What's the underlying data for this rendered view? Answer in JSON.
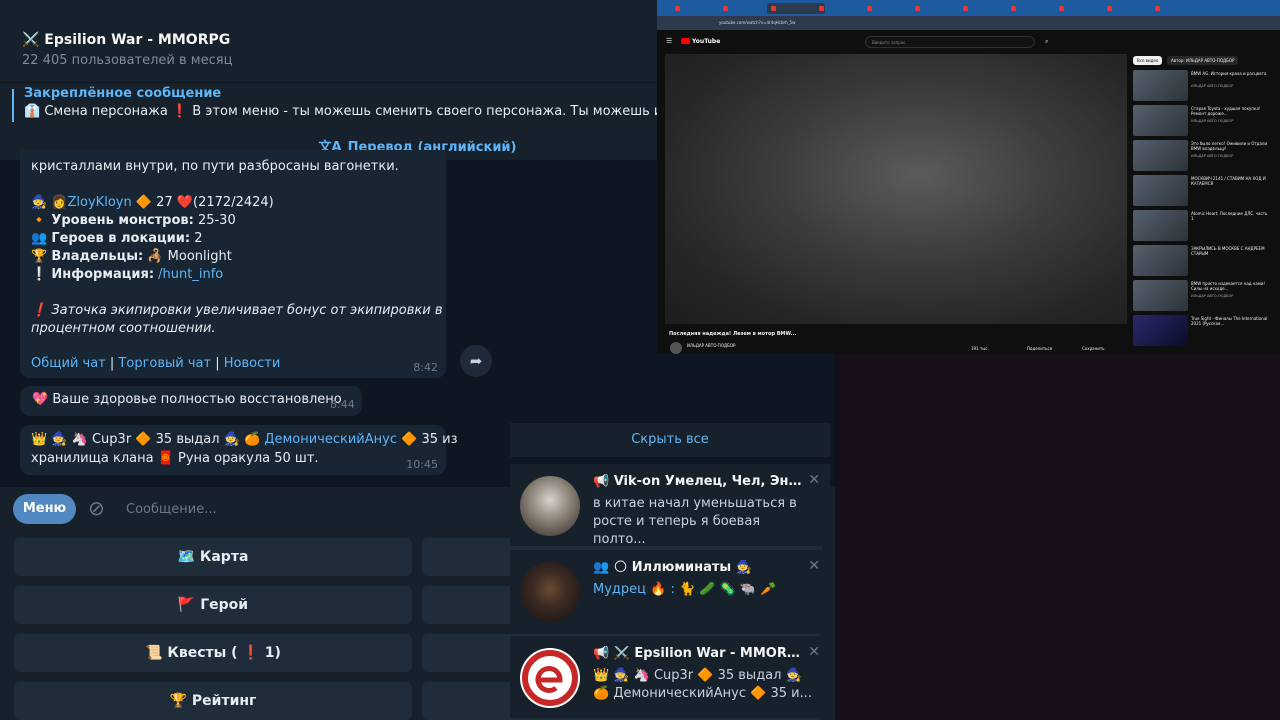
{
  "telegram": {
    "header": {
      "title": "⚔️ Epsilion War - MMORPG",
      "subtitle": "22 405 пользователей в месяц"
    },
    "pinned": {
      "label": "Закреплённое сообщение",
      "text": "👔 Смена персонажа ❗ В этом меню - ты можешь сменить своего персонажа. Ты можешь иметь д"
    },
    "translate_label": "Перевод (английский)",
    "message1": {
      "lines": [
        "кристаллами внутри, по пути разбросаны вагонетки.",
        "🧙 👩 ZloyKloyn 🔶 27 ❤️ (2172/2424)",
        "🔸 Уровень монстров: 25-30",
        "👥 Героев в локации: 2",
        "🏆 Владельцы: 🦂 Moonlight",
        "❕ Информация: /hunt_info",
        "❗ Заточка экипировки увеличивает бонус от экипировки в",
        "процентном соотношении."
      ],
      "player_name": "ZloyKloyn",
      "level": "27",
      "hp": "(2172/2424)",
      "monster_level_label": "Уровень монстров:",
      "monster_level": "25-30",
      "heroes_label": "Героев в локации:",
      "heroes": "2",
      "owners_label": "Владельцы:",
      "owners": "Moonlight",
      "info_label": "Информация:",
      "info_link": "/hunt_info",
      "tip_1": "Заточка экипировки увеличивает бонус от экипировки в",
      "tip_2": "процентном соотношении.",
      "links": [
        "Общий чат",
        "Торговый чат",
        "Новости"
      ],
      "time": "8:42"
    },
    "message2": {
      "text": "💖 Ваше здоровье полностью восстановлено",
      "time": "8:44"
    },
    "message3": {
      "line1_player": "Cup3r",
      "line1_level": "35 выдал",
      "line1_target": "ДемоническийАнус",
      "line1_tail": "35 из",
      "line2": "хранилища клана 🧧 Руна оракула 50 шт.",
      "time": "10:45"
    },
    "input": {
      "menu_label": "Меню",
      "placeholder": "Сообщение..."
    },
    "keyboard": [
      {
        "label": "🗺️ Карта"
      },
      {
        "label": "🚩 Герой"
      },
      {
        "label": "📜 Квесты ( ❗ 1)"
      },
      {
        "label": "🏆 Рейтинг"
      }
    ]
  },
  "notifications": {
    "hide_all": "Скрыть все",
    "items": [
      {
        "title": "📢 Vik-on Умелец, Чел, Энтузи...",
        "text": "в китае начал уменьшаться в росте и теперь я боевая полто..."
      },
      {
        "title": "👥 🌕 Иллюминаты 🧙",
        "text": "Мудрец 🔥 : 🐈 🥒 🦠 🐃 🥕"
      },
      {
        "title": "📢 ⚔️ Epsilion War - MMORPG",
        "text": "👑 🧙 🦄 Cup3r 🔶 35 выдал 🧙 🍊 ДемоническийАнус 🔶 35 и..."
      }
    ]
  },
  "youtube": {
    "url": "youtube.com/watch?v=4r4qHcbrh_5w",
    "logo": "YouTube",
    "search_placeholder": "Введите запрос",
    "video_title": "Последняя надежда! Лезем в мотор BMW...",
    "channel": "ИЛЬДАР АВТО-ПОДБОР",
    "likes": "191 тыс.",
    "actions": [
      "Поделиться",
      "Сохранить"
    ],
    "chips": [
      "Все видео",
      "Автор: ИЛЬДАР АВТО-ПОДБОР"
    ],
    "recommendations": [
      {
        "title": "BMW AG. История краха и расцвета",
        "meta": "ИЛЬДАР АВТО-ПОДБОР"
      },
      {
        "title": "Старая Toyota - худшая покупка! Ремонт дороже...",
        "meta": "ИЛЬДАР АВТО-ПОДБОР"
      },
      {
        "title": "Это было легко! Оживили и Отдали BMW владельцу!",
        "meta": "ИЛЬДАР АВТО-ПОДБОР"
      },
      {
        "title": "МОСКВИЧ 2141 / СТАВИМ НА ХОД И КАТАЕМСЯ",
        "meta": ""
      },
      {
        "title": "Atomic Heart. Последние ДЛС. часть 1",
        "meta": ""
      },
      {
        "title": "ЗАКРЫЛИСЬ В МОСКВЕ С АНДРЕЕМ СТАРЫМ",
        "meta": ""
      },
      {
        "title": "BMW просто издевается над нами! Силы на исходе...",
        "meta": "ИЛЬДАР АВТО-ПОДБОР"
      },
      {
        "title": "True Sight - Финалы The International 2021 (Русская...",
        "meta": ""
      }
    ]
  },
  "colors": {
    "tg_bg": "#0e1621",
    "tg_panel": "#17212b",
    "bubble": "#182533",
    "accent": "#5eb5f7",
    "menu_btn": "#5288c1",
    "desktop": "#180e1a"
  }
}
